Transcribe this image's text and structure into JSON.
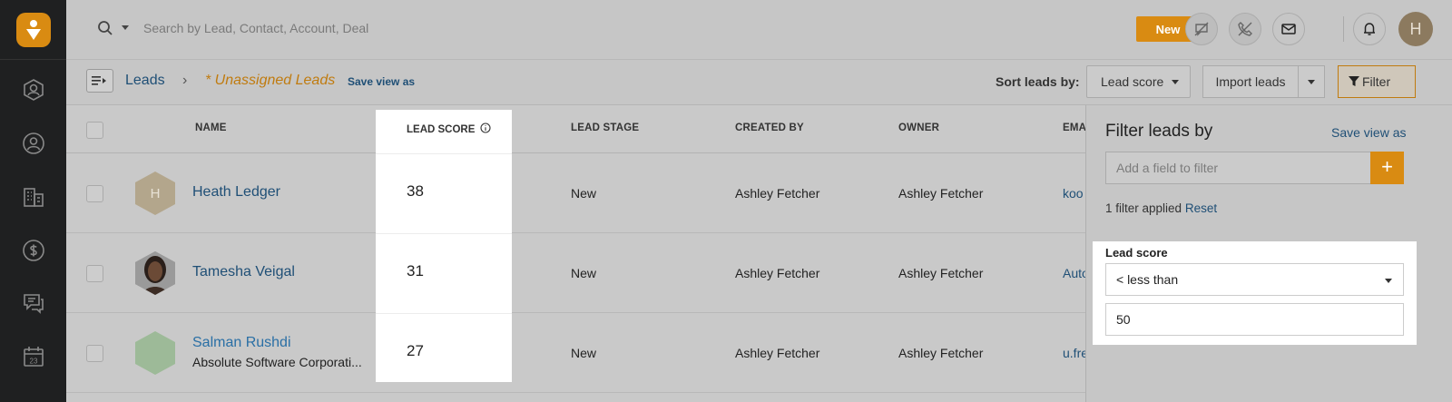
{
  "sidebar": {
    "logo": "freshsales-logo",
    "items": [
      {
        "name": "contacts-icon",
        "label": "Contacts"
      },
      {
        "name": "leads-icon",
        "label": "Leads"
      },
      {
        "name": "accounts-icon",
        "label": "Accounts"
      },
      {
        "name": "deals-icon",
        "label": "Deals"
      },
      {
        "name": "conversations-icon",
        "label": "Conversations"
      },
      {
        "name": "calendar-icon",
        "label": "Calendar"
      }
    ],
    "calendar_day": "23"
  },
  "header": {
    "search_placeholder": "Search by Lead, Contact, Account, Deal",
    "new_button": "New",
    "avatar_initial": "H",
    "brand_color": "#d98b12"
  },
  "subheader": {
    "breadcrumb_root": "Leads",
    "breadcrumb_sep": "›",
    "current_view": "* Unassigned Leads",
    "save_view": "Save view as",
    "sort_label": "Sort leads by:",
    "sort_value": "Lead score",
    "import_button": "Import leads",
    "filter_button": "Filter"
  },
  "table": {
    "columns": {
      "name": "NAME",
      "lead_score": "LEAD SCORE",
      "lead_stage": "LEAD STAGE",
      "created_by": "CREATED BY",
      "owner": "OWNER",
      "email": "EMA"
    },
    "rows": [
      {
        "name": "Heath Ledger",
        "company": "",
        "avatar": "H",
        "score": "38",
        "stage": "New",
        "created_by": "Ashley Fetcher",
        "owner": "Ashley Fetcher",
        "email": "koo"
      },
      {
        "name": "Tamesha Veigal",
        "company": "",
        "avatar": "",
        "score": "31",
        "stage": "New",
        "created_by": "Ashley Fetcher",
        "owner": "Ashley Fetcher",
        "email": "Auto"
      },
      {
        "name": "Salman Rushdi",
        "company": "Absolute Software Corporati...",
        "avatar": "",
        "score": "27",
        "stage": "New",
        "created_by": "Ashley Fetcher",
        "owner": "Ashley Fetcher",
        "email": "u.fre"
      }
    ]
  },
  "filter_panel": {
    "title": "Filter leads by",
    "save_view": "Save view as",
    "field_placeholder": "Add a field to filter",
    "add_label": "+",
    "applied_text": "1 filter applied",
    "reset": "Reset",
    "lead_score_label": "Lead score",
    "operator": "< less than",
    "value": "50"
  }
}
